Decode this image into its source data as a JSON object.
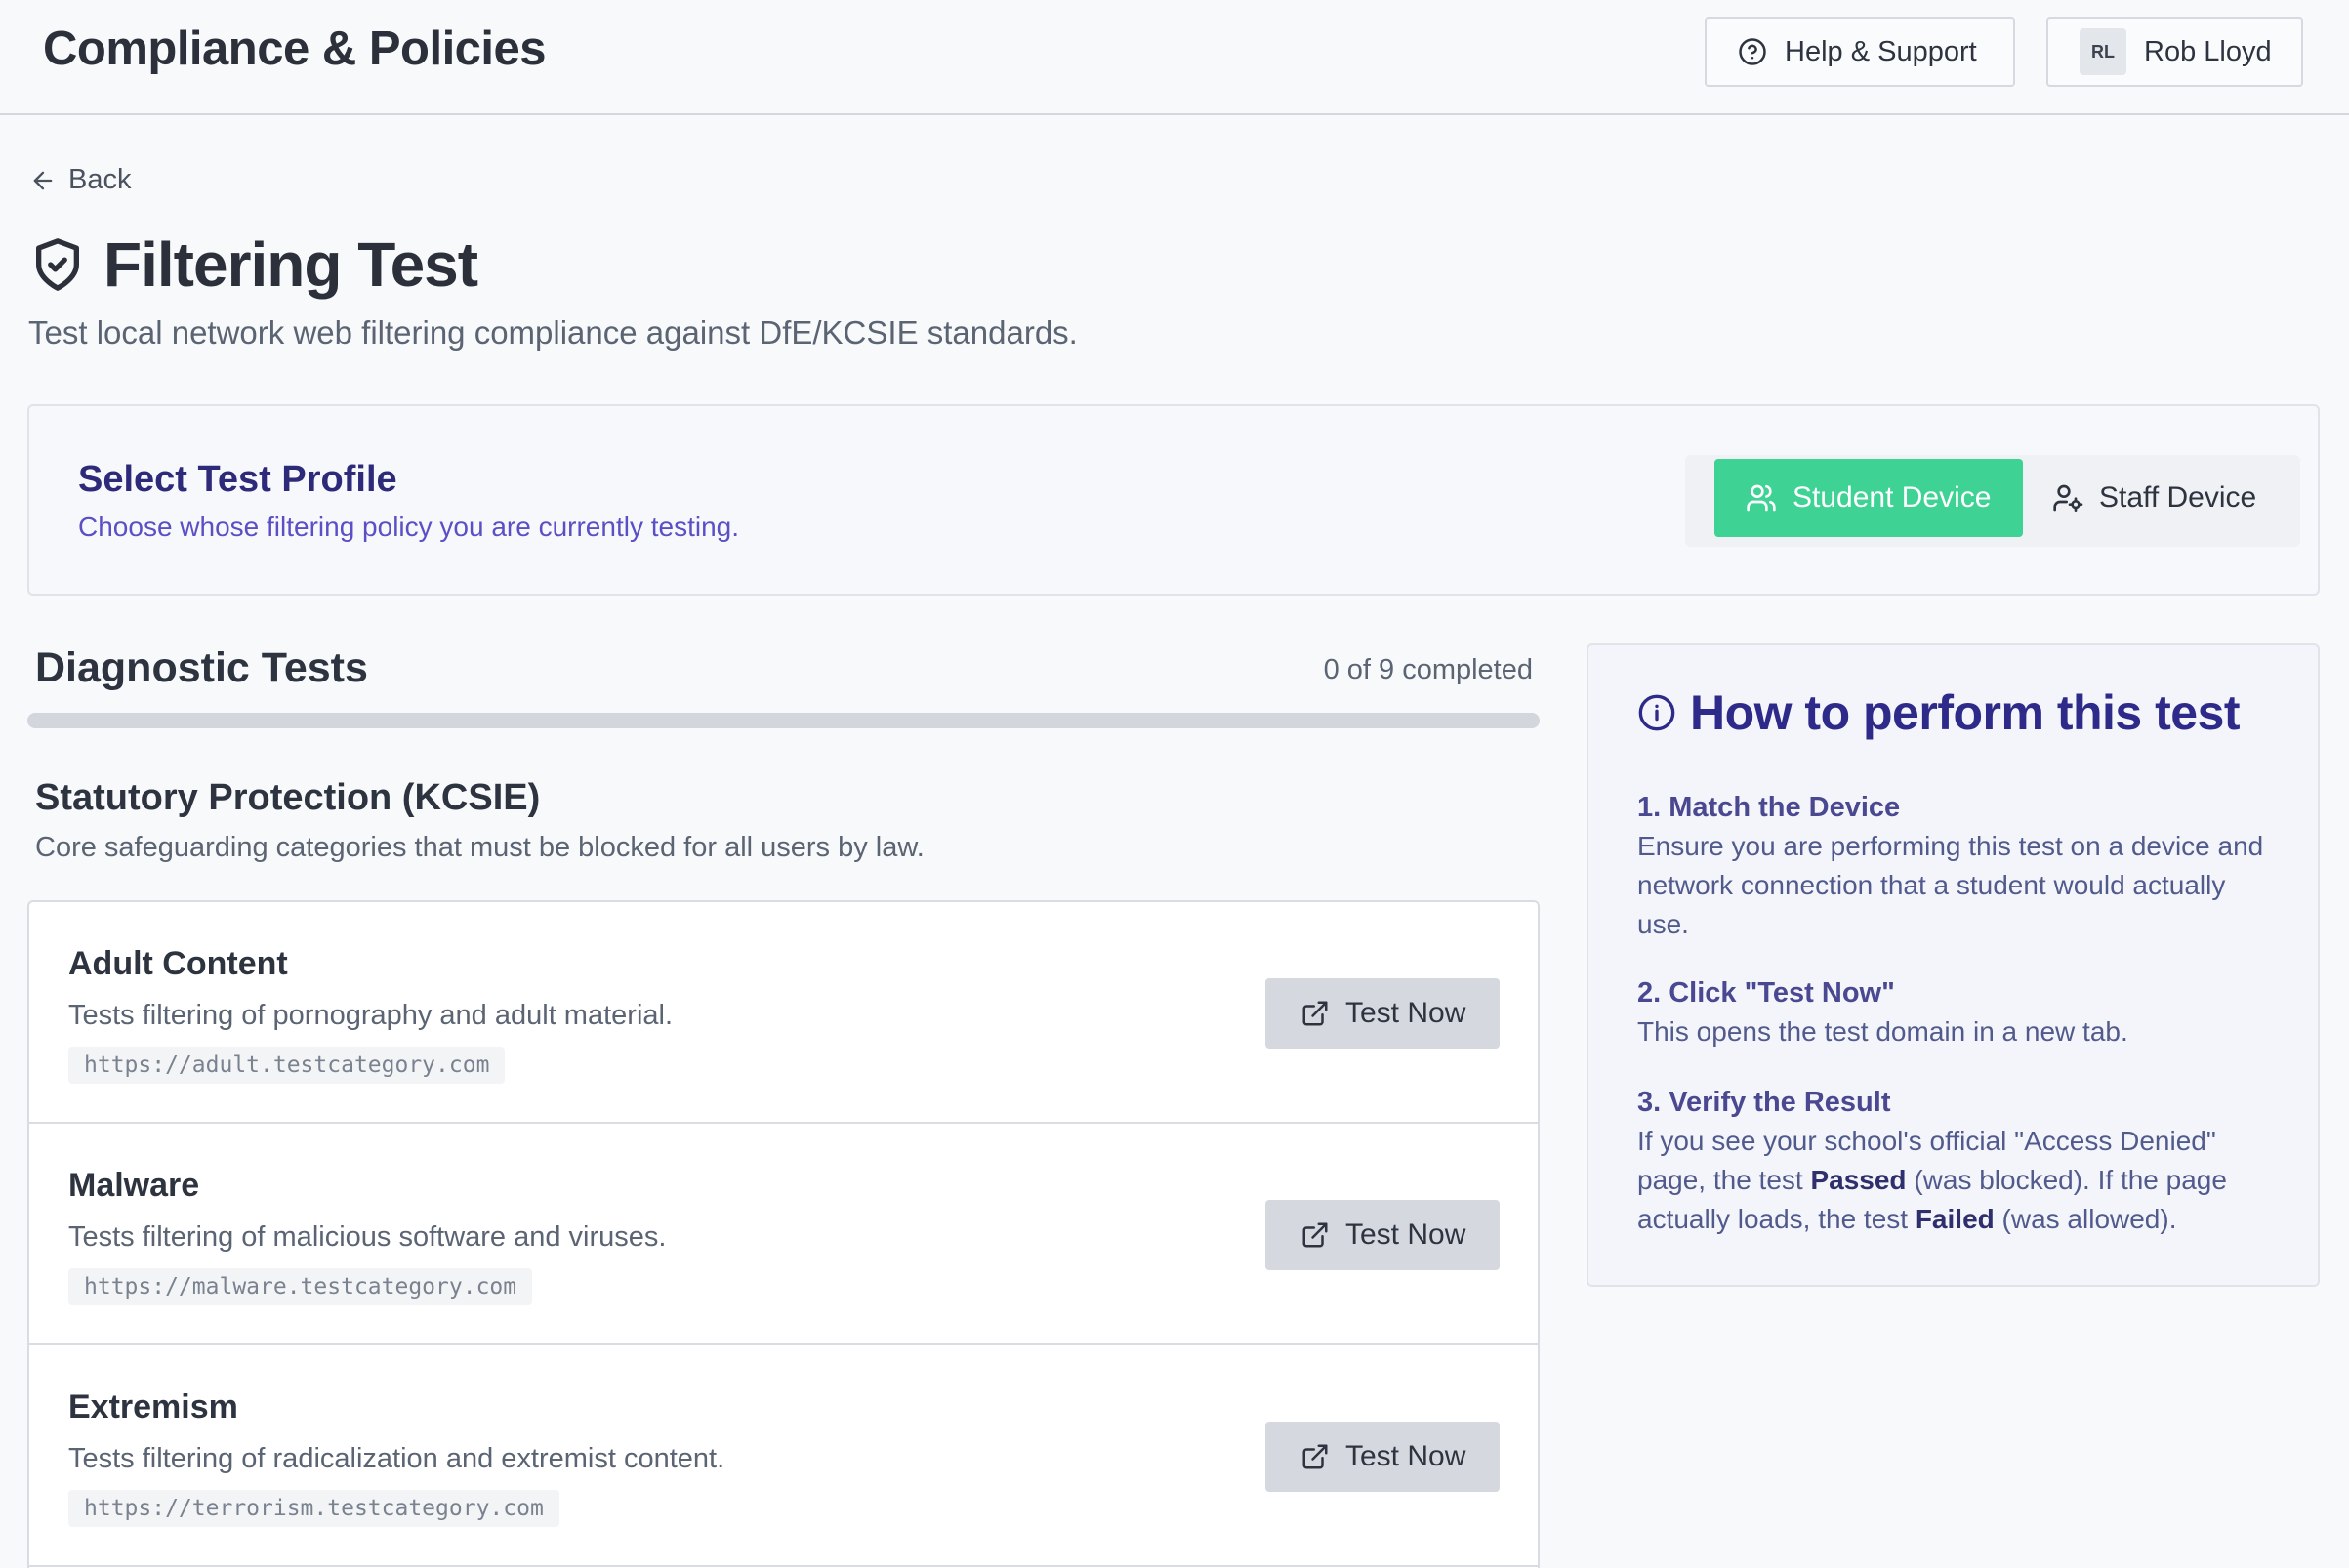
{
  "header": {
    "app_title": "Compliance & Policies",
    "help_label": "Help & Support",
    "user_initials": "RL",
    "user_name": "Rob Lloyd"
  },
  "nav": {
    "back_label": "Back"
  },
  "page": {
    "title": "Filtering Test",
    "subtitle": "Test local network web filtering compliance against DfE/KCSIE standards."
  },
  "profile": {
    "title": "Select Test Profile",
    "description": "Choose whose filtering policy you are currently testing.",
    "options": [
      {
        "label": "Student Device",
        "selected": true
      },
      {
        "label": "Staff Device",
        "selected": false
      }
    ],
    "accent_color": "#3ed394"
  },
  "diagnostics": {
    "title": "Diagnostic Tests",
    "progress_label": "0 of 9 completed",
    "completed": 0,
    "total": 9
  },
  "section": {
    "title": "Statutory Protection (KCSIE)",
    "description": "Core safeguarding categories that must be blocked for all users by law."
  },
  "tests": [
    {
      "name": "Adult Content",
      "description": "Tests filtering of pornography and adult material.",
      "url": "https://adult.testcategory.com",
      "button": "Test Now"
    },
    {
      "name": "Malware",
      "description": "Tests filtering of malicious software and viruses.",
      "url": "https://malware.testcategory.com",
      "button": "Test Now"
    },
    {
      "name": "Extremism",
      "description": "Tests filtering of radicalization and extremist content.",
      "url": "https://terrorism.testcategory.com",
      "button": "Test Now"
    }
  ],
  "howto": {
    "title": "How to perform this test",
    "steps": [
      {
        "title": "1. Match the Device",
        "text": "Ensure you are performing this test on a device and network connection that a student would actually use."
      },
      {
        "title": "2. Click \"Test Now\"",
        "text": "This opens the test domain in a new tab."
      },
      {
        "title": "3. Verify the Result",
        "text_a": "If you see your school's official \"Access Denied\" page, the test ",
        "passed": "Passed",
        "text_b": " (was blocked). If the page actually loads, the test ",
        "failed": "Failed",
        "text_c": " (was allowed)."
      }
    ]
  },
  "icons": {
    "help": "help-circle-icon",
    "back": "arrow-left-icon",
    "title": "shield-check-icon",
    "student": "users-icon",
    "staff": "user-cog-icon",
    "test": "external-link-icon",
    "info": "info-icon"
  }
}
